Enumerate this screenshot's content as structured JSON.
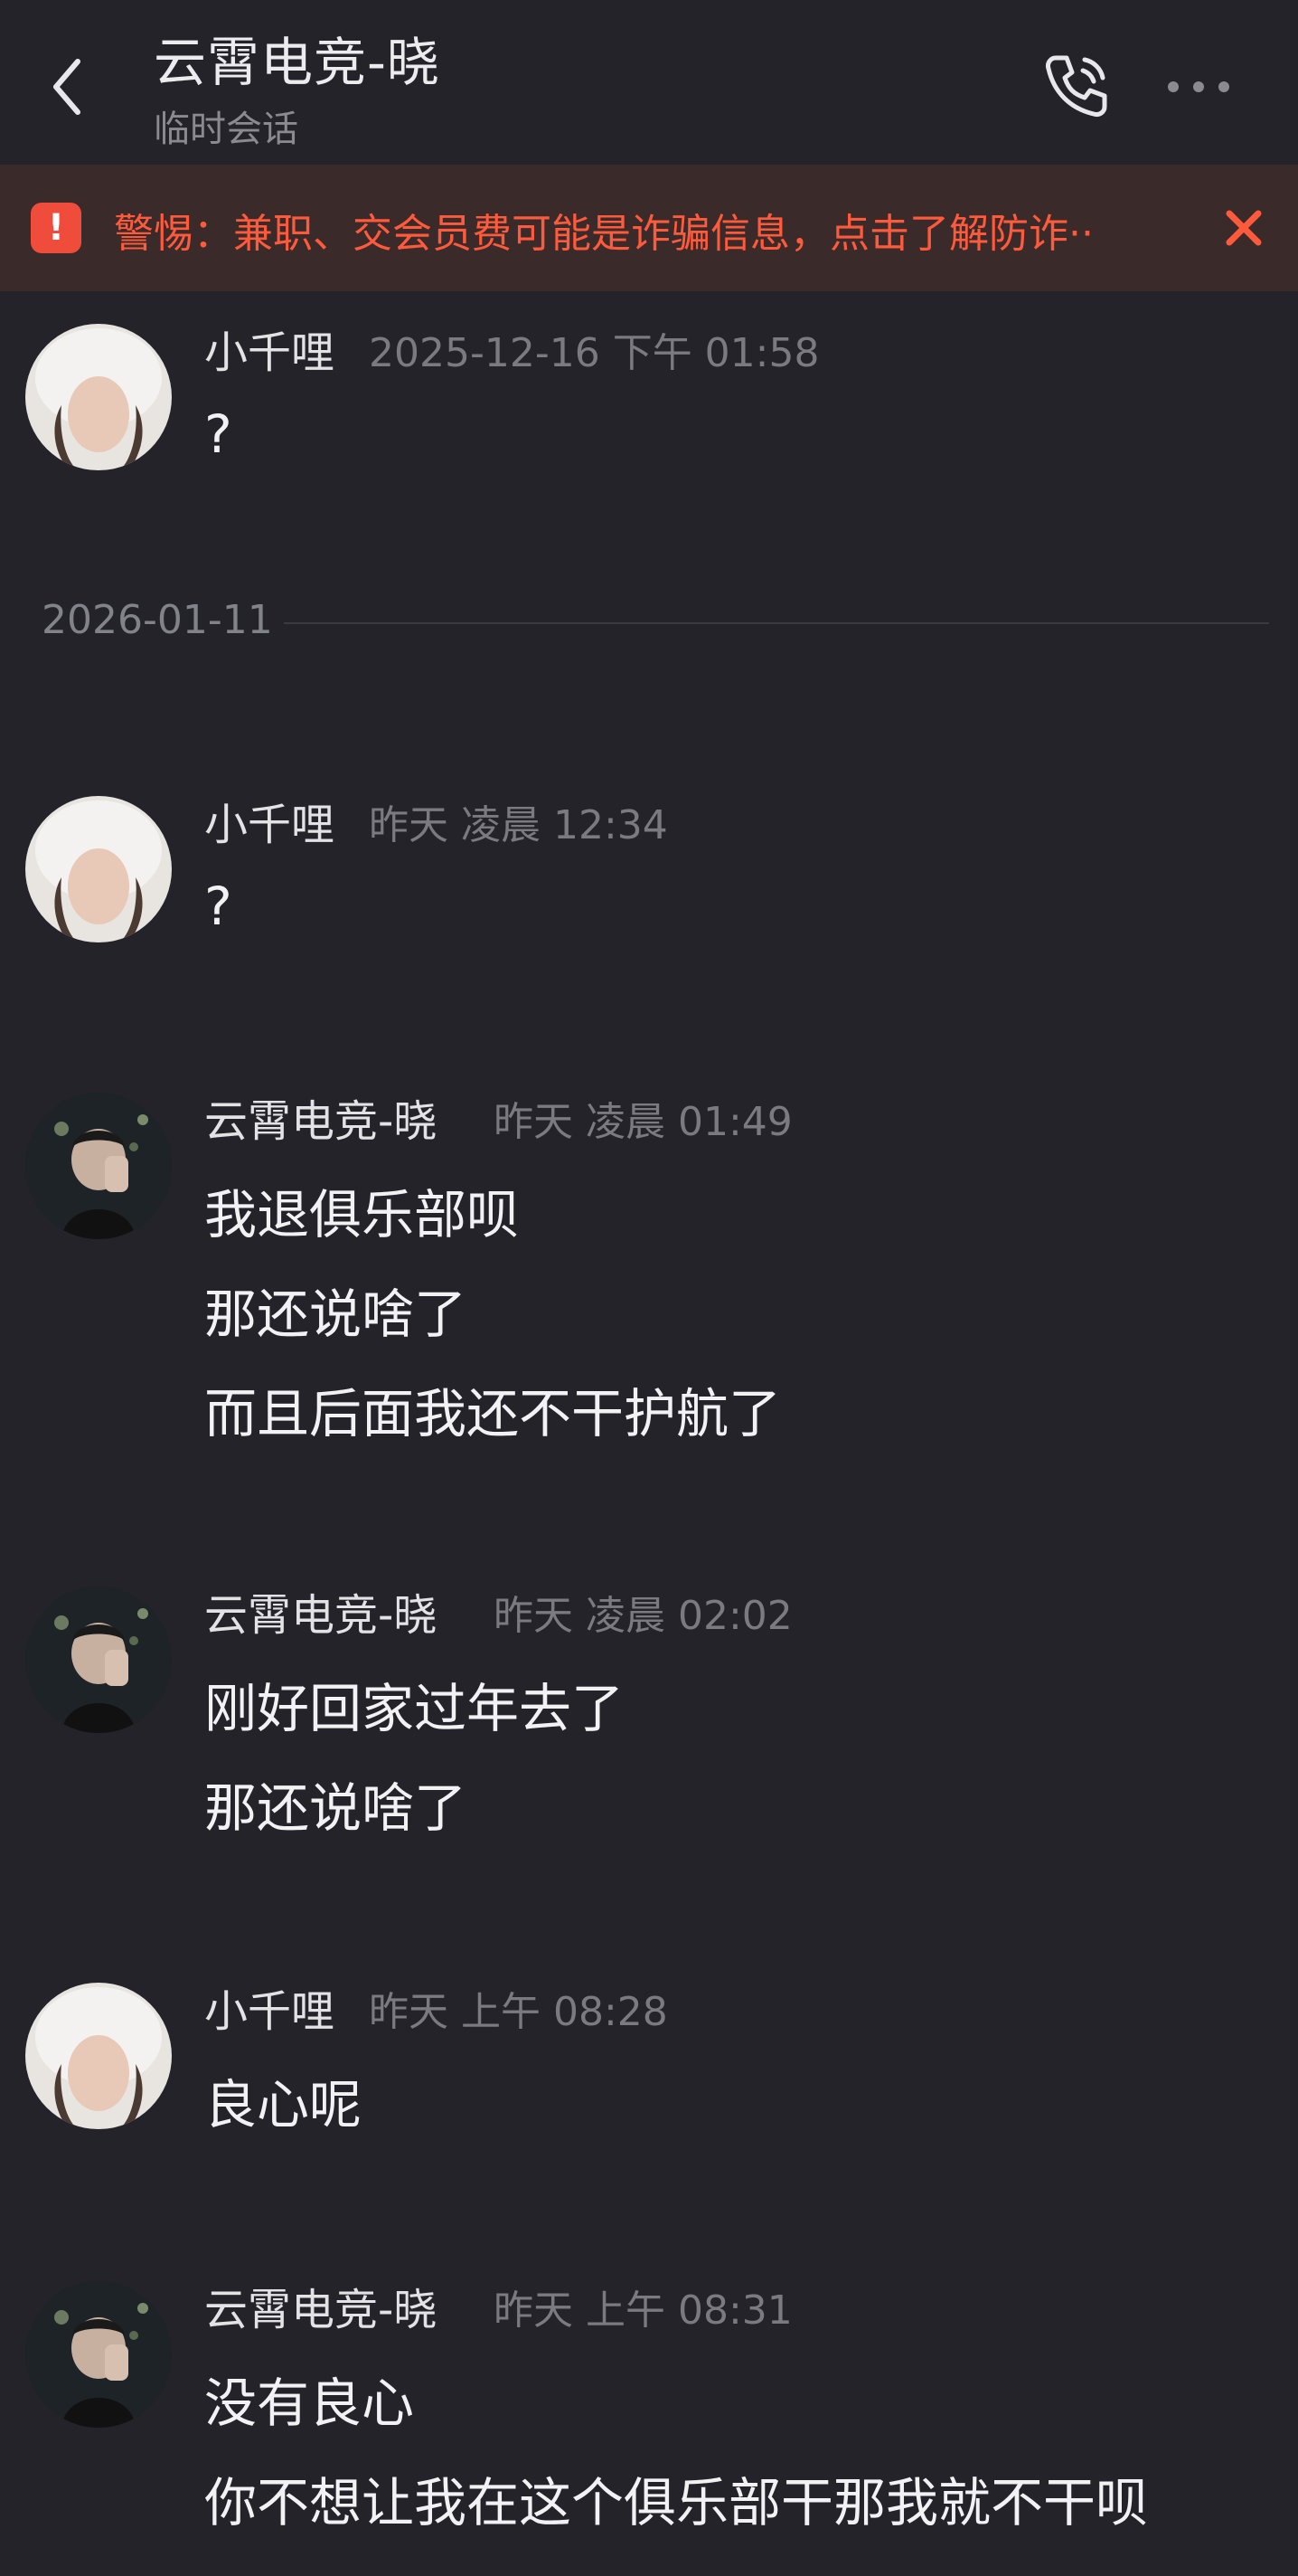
{
  "header": {
    "title": "云霄电竞-晓",
    "subtitle": "临时会话",
    "back_icon": "chevron-left-icon",
    "call_icon": "phone-icon",
    "more_icon": "more-dots-icon"
  },
  "warning": {
    "text": "警惕：兼职、交会员费可能是诈骗信息，点击了解防诈··",
    "icon": "alert-icon",
    "close_icon": "close-icon",
    "color": "#ff5a3c"
  },
  "date_separator": "2026-01-11",
  "messages": [
    {
      "sender": "小千哩",
      "time": "2025-12-16 下午 01:58",
      "lines": [
        "?"
      ]
    },
    {
      "sender": "小千哩",
      "time": "昨天 凌晨 12:34",
      "lines": [
        "?"
      ]
    },
    {
      "sender": "云霄电竞-晓",
      "time": "昨天 凌晨 01:49",
      "lines": [
        "我退俱乐部呗",
        "那还说啥了",
        "而且后面我还不干护航了"
      ]
    },
    {
      "sender": "云霄电竞-晓",
      "time": "昨天 凌晨 02:02",
      "lines": [
        "刚好回家过年去了",
        "那还说啥了"
      ]
    },
    {
      "sender": "小千哩",
      "time": "昨天 上午 08:28",
      "lines": [
        "良心呢"
      ]
    },
    {
      "sender": "云霄电竞-晓",
      "time": "昨天 上午 08:31",
      "lines": [
        "没有良心",
        "你不想让我在这个俱乐部干那我就不干呗"
      ]
    }
  ]
}
